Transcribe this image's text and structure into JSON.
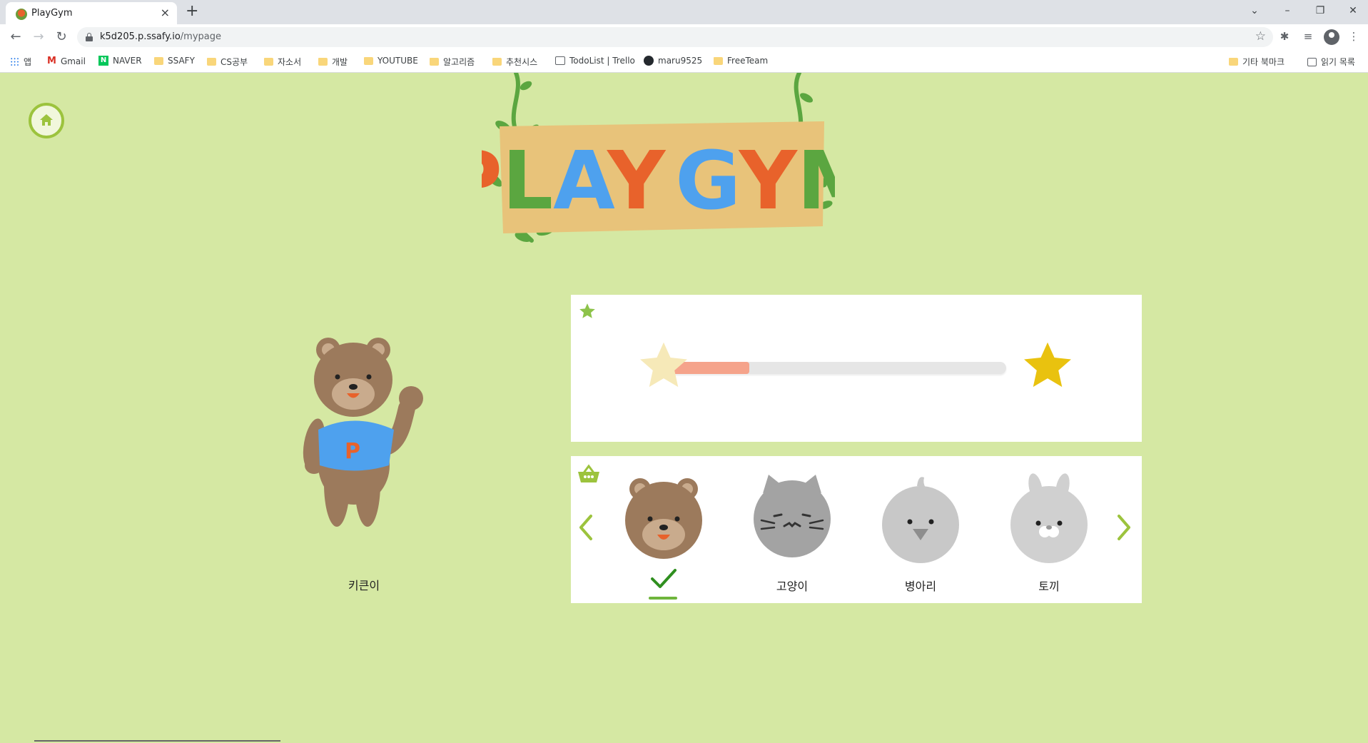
{
  "browser": {
    "tab_title": "PlayGym",
    "new_tab": "+",
    "url_host": "k5d205.p.ssafy.io",
    "url_path": "/mypage",
    "window_controls": {
      "tabsearch": "⌄",
      "minimize": "–",
      "restore": "❐",
      "close": "✕"
    },
    "bookmarks": [
      {
        "label": "앱",
        "icon": "apps-icon"
      },
      {
        "label": "Gmail",
        "icon": "gmail-icon"
      },
      {
        "label": "NAVER",
        "icon": "naver-icon"
      },
      {
        "label": "SSAFY",
        "icon": "folder-icon"
      },
      {
        "label": "CS공부",
        "icon": "folder-icon"
      },
      {
        "label": "자소서",
        "icon": "folder-icon"
      },
      {
        "label": "개발",
        "icon": "folder-icon"
      },
      {
        "label": "YOUTUBE",
        "icon": "folder-icon"
      },
      {
        "label": "알고리즘",
        "icon": "folder-icon"
      },
      {
        "label": "추천시스",
        "icon": "folder-icon"
      },
      {
        "label": "TodoList | Trello",
        "icon": "trello-icon"
      },
      {
        "label": "maru9525",
        "icon": "github-icon"
      },
      {
        "label": "FreeTeam",
        "icon": "folder-icon"
      }
    ],
    "other_bookmarks": "기타 북마크",
    "reading_list": "읽기 목록"
  },
  "page": {
    "logo_text": "PLAY GYM",
    "avatar_name": "키큰이",
    "level": {
      "progress_fraction": 0.25
    },
    "characters": [
      {
        "label": "",
        "animal": "bear",
        "selected": true
      },
      {
        "label": "고양이",
        "animal": "cat",
        "selected": false
      },
      {
        "label": "병아리",
        "animal": "chick",
        "selected": false
      },
      {
        "label": "토끼",
        "animal": "rabbit",
        "selected": false
      }
    ]
  },
  "colors": {
    "page_bg": "#d5e8a3",
    "accent_green": "#9cc33d",
    "progress_fill": "#f5a38b",
    "star_gold": "#e9c20f",
    "star_pale": "#f6e9b8",
    "bear_brown": "#9c7a5c",
    "shirt_blue": "#4ea1ee"
  }
}
